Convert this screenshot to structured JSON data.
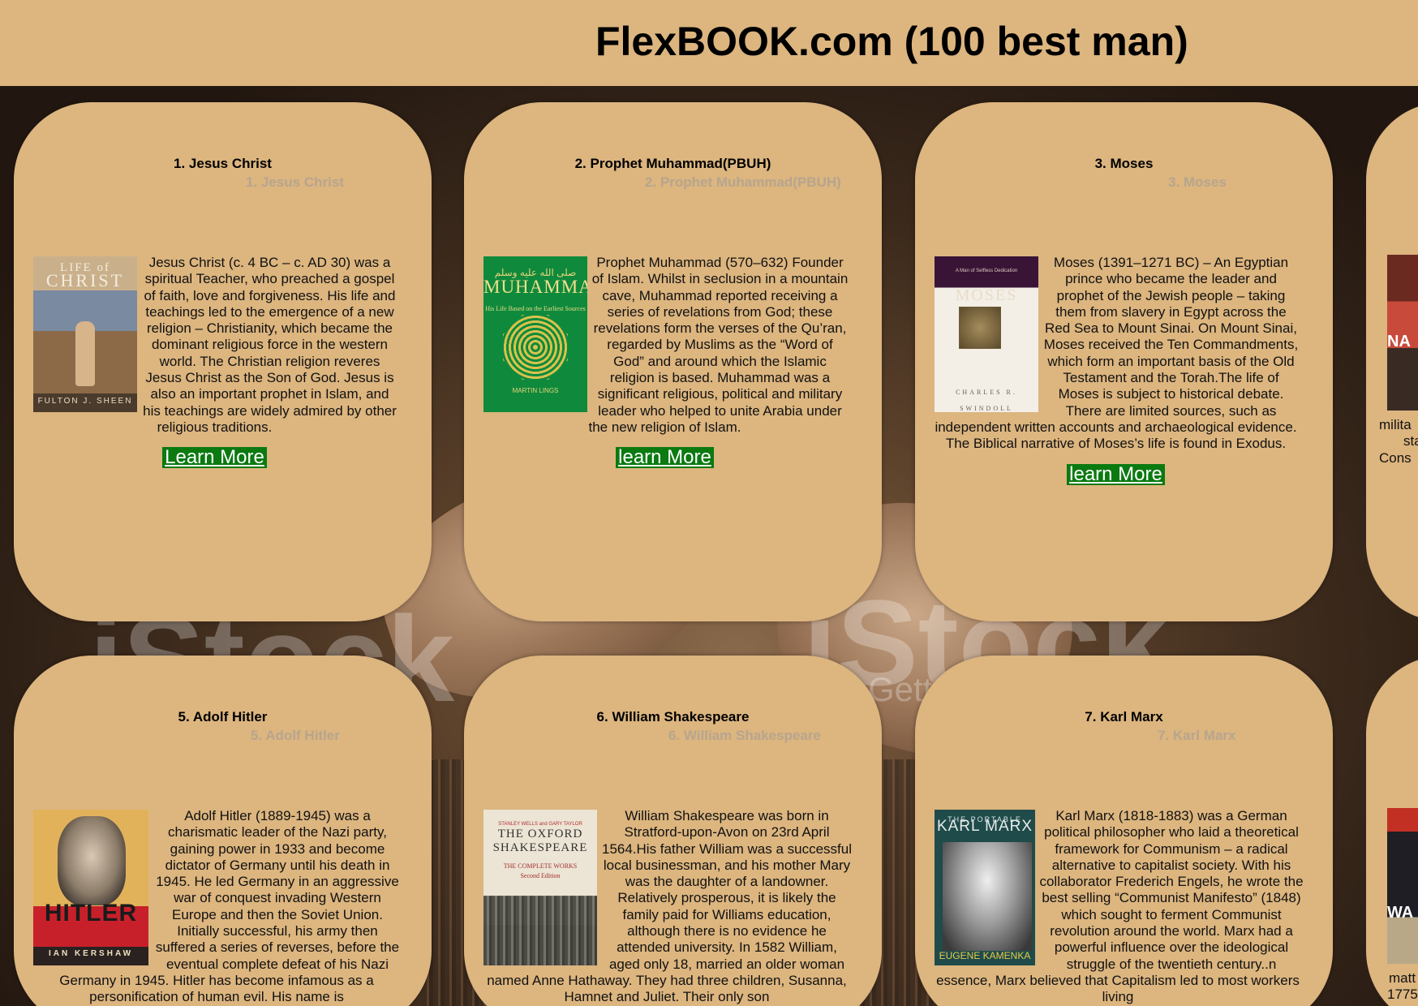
{
  "site": {
    "title": "FlexBOOK.com (100 best man)"
  },
  "watermarks": [
    "iStock",
    "iStock",
    "Getty Images"
  ],
  "cards": [
    {
      "title": "1. Jesus Christ",
      "alt_title": "1. Jesus Christ",
      "cover": {
        "line1": "LIFE of",
        "line2": "CHRIST",
        "author": "FULTON J. SHEEN"
      },
      "description": "Jesus Christ (c. 4 BC – c. AD 30) was a spiritual Teacher, who preached a gospel of faith, love and forgiveness. His life and teachings led to the emergence of a new religion – Christianity, which became the dominant religious force in the western world. The Christian religion reveres Jesus Christ as the Son of God. Jesus is also an important prophet in Islam, and his teachings are widely admired by other religious traditions.",
      "button": "Learn More"
    },
    {
      "title": "2. Prophet Muhammad(PBUH)",
      "alt_title": "2. Prophet Muhammad(PBUH)",
      "cover": {
        "arabic": "صلى الله عليه وسلم",
        "title": "MUHAMMAD",
        "subtitle": "His Life Based on the Earliest Sources",
        "author": "MARTIN LINGS"
      },
      "description": "Prophet Muhammad (570–632) Founder of Islam. Whilst in seclusion in a mountain cave, Muhammad reported receiving a series of revelations from God; these revelations form the verses of the Qu’ran, regarded by Muslims as the “Word of God” and around which the Islamic religion is based. Muhammad was a significant religious, political and military leader who helped to unite Arabia under the new religion of Islam.",
      "button": "learn More"
    },
    {
      "title": "3. Moses",
      "alt_title": "3. Moses",
      "cover": {
        "tag": "A Man of Selfless Dedication",
        "title": "MOSES",
        "author": "CHARLES R. SWINDOLL"
      },
      "description": "Moses (1391–1271 BC) – An Egyptian prince who became the leader and prophet of the Jewish people – taking them from slavery in Egypt across the Red Sea to Mount Sinai. On Mount Sinai, Moses received the Ten Commandments, which form an important basis of the Old Testament and the Torah.The life of Moses is subject to historical debate. There are limited sources, such as independent written accounts and archaeological evidence. The Biblical narrative of Moses’s life is found in Exodus.",
      "button": "learn More"
    },
    {
      "title": "5. Adolf Hitler",
      "alt_title": "5. Adolf Hitler",
      "cover": {
        "title": "HITLER",
        "author": "IAN KERSHAW"
      },
      "description": "Adolf Hitler (1889-1945) was a charismatic leader of the Nazi party, gaining power in 1933 and become dictator of Germany until his death in 1945. He led Germany in an aggressive war of conquest invading Western Europe and then the Soviet Union. Initially successful, his army then suffered a series of reverses, before the eventual complete defeat of his Nazi Germany in 1945. Hitler has become infamous as a personification of human evil. His name is",
      "button": ""
    },
    {
      "title": "6. William Shakespeare",
      "alt_title": "6. William Shakespeare",
      "cover": {
        "top": "STANLEY WELLS and GARY TAYLOR",
        "title": "THE OXFORD SHAKESPEARE",
        "subtitle": "THE COMPLETE WORKS",
        "edition": "Second Edition"
      },
      "description": "William Shakespeare was born in Stratford-upon-Avon on 23rd April 1564.His father William was a successful local businessman, and his mother Mary was the daughter of a landowner. Relatively prosperous, it is likely the family paid for Williams education, although there is no evidence he attended university. In 1582 William, aged only 18, married an older woman named Anne Hathaway. They had three children, Susanna, Hamnet and Juliet. Their only son",
      "button": ""
    },
    {
      "title": "7. Karl Marx",
      "alt_title": "7. Karl Marx",
      "cover": {
        "top": "THE PORTABLE",
        "title": "KARL MARX",
        "author": "EUGENE KAMENKA"
      },
      "description": "Karl Marx (1818-1883) was a German political philosopher who laid a theoretical framework for Communism – a radical alternative to capitalist society. With his collaborator Frederich Engels, he wrote the best selling “Communist Manifesto” (1848) which sought to ferment Communist revolution around the world. Marx had a powerful influence over the ideological struggle of the twentieth century..n essence, Marx believed that Capitalism led to most workers living",
      "button": ""
    }
  ],
  "partial_cards": [
    {
      "cover_text": "NA",
      "lines": [
        "milita",
        "sta",
        "Cons"
      ]
    },
    {
      "cover_text": "WA",
      "lines": [
        "matt",
        "1775"
      ]
    }
  ]
}
